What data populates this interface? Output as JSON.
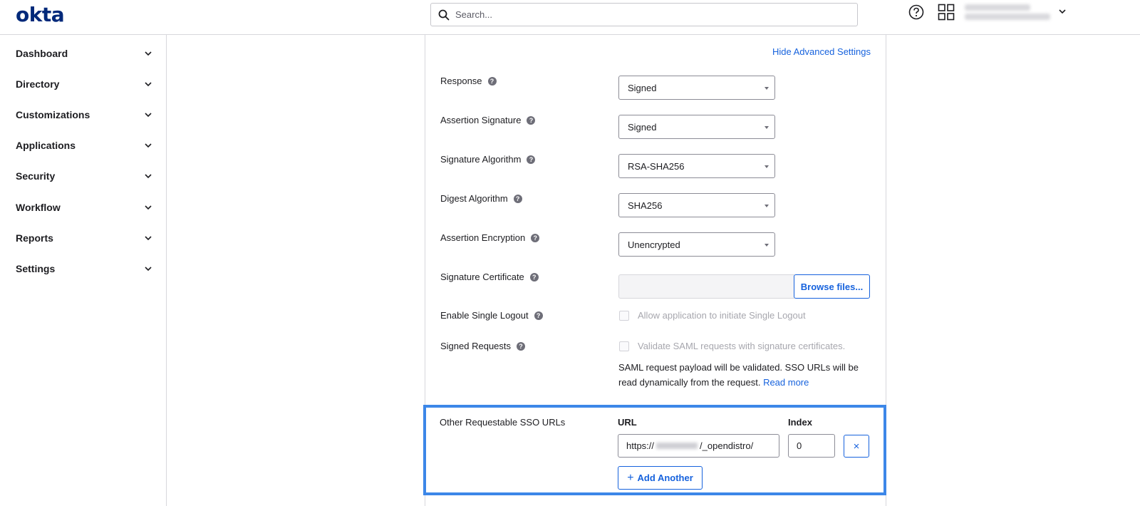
{
  "header": {
    "logo_text": "okta",
    "search_placeholder": "Search...",
    "help_icon": "question-circle-icon",
    "apps_icon": "grid-icon",
    "user_chevron_icon": "chevron-down-icon"
  },
  "sidebar": {
    "items": [
      {
        "label": "Dashboard"
      },
      {
        "label": "Directory"
      },
      {
        "label": "Customizations"
      },
      {
        "label": "Applications"
      },
      {
        "label": "Security"
      },
      {
        "label": "Workflow"
      },
      {
        "label": "Reports"
      },
      {
        "label": "Settings"
      }
    ]
  },
  "settings": {
    "hide_advanced_label": "Hide Advanced Settings",
    "response": {
      "label": "Response",
      "value": "Signed"
    },
    "assertion_signature": {
      "label": "Assertion Signature",
      "value": "Signed"
    },
    "signature_algorithm": {
      "label": "Signature Algorithm",
      "value": "RSA-SHA256"
    },
    "digest_algorithm": {
      "label": "Digest Algorithm",
      "value": "SHA256"
    },
    "assertion_encryption": {
      "label": "Assertion Encryption",
      "value": "Unencrypted"
    },
    "signature_certificate": {
      "label": "Signature Certificate",
      "browse_label": "Browse files..."
    },
    "single_logout": {
      "label": "Enable Single Logout",
      "checkbox_label": "Allow application to initiate Single Logout"
    },
    "signed_requests": {
      "label": "Signed Requests",
      "checkbox_label": "Validate SAML requests with signature certificates.",
      "help_text": "SAML request payload will be validated. SSO URLs will be read dynamically from the request.",
      "read_more": "Read more"
    },
    "other_sso": {
      "label": "Other Requestable SSO URLs",
      "url_header": "URL",
      "index_header": "Index",
      "url_prefix": "https://",
      "url_suffix": "/_opendistro/",
      "index_value": "0",
      "remove_label": "×",
      "add_label": "Add Another",
      "add_icon": "+"
    }
  },
  "colors": {
    "brand": "#00297a",
    "link": "#1662dd",
    "highlight": "#3c87e8"
  }
}
